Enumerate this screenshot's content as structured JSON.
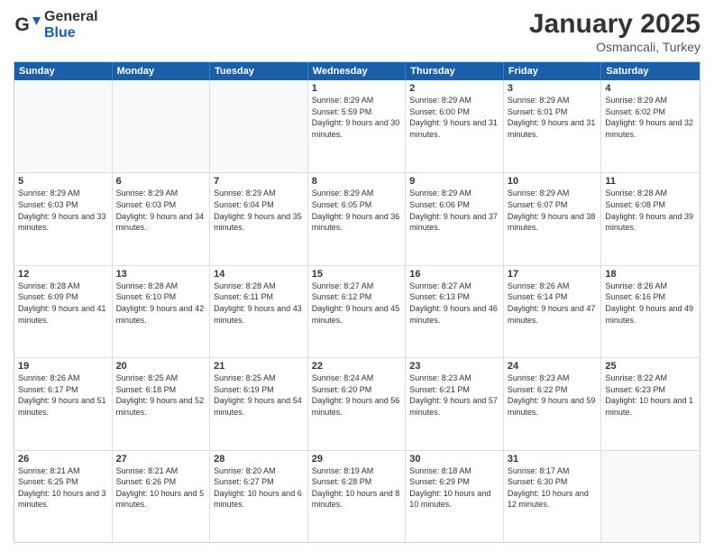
{
  "logo": {
    "general": "General",
    "blue": "Blue"
  },
  "title": "January 2025",
  "subtitle": "Osmancali, Turkey",
  "days_of_week": [
    "Sunday",
    "Monday",
    "Tuesday",
    "Wednesday",
    "Thursday",
    "Friday",
    "Saturday"
  ],
  "weeks": [
    [
      {
        "day": "",
        "info": ""
      },
      {
        "day": "",
        "info": ""
      },
      {
        "day": "",
        "info": ""
      },
      {
        "day": "1",
        "info": "Sunrise: 8:29 AM\nSunset: 5:59 PM\nDaylight: 9 hours and 30 minutes."
      },
      {
        "day": "2",
        "info": "Sunrise: 8:29 AM\nSunset: 6:00 PM\nDaylight: 9 hours and 31 minutes."
      },
      {
        "day": "3",
        "info": "Sunrise: 8:29 AM\nSunset: 6:01 PM\nDaylight: 9 hours and 31 minutes."
      },
      {
        "day": "4",
        "info": "Sunrise: 8:29 AM\nSunset: 6:02 PM\nDaylight: 9 hours and 32 minutes."
      }
    ],
    [
      {
        "day": "5",
        "info": "Sunrise: 8:29 AM\nSunset: 6:03 PM\nDaylight: 9 hours and 33 minutes."
      },
      {
        "day": "6",
        "info": "Sunrise: 8:29 AM\nSunset: 6:03 PM\nDaylight: 9 hours and 34 minutes."
      },
      {
        "day": "7",
        "info": "Sunrise: 8:29 AM\nSunset: 6:04 PM\nDaylight: 9 hours and 35 minutes."
      },
      {
        "day": "8",
        "info": "Sunrise: 8:29 AM\nSunset: 6:05 PM\nDaylight: 9 hours and 36 minutes."
      },
      {
        "day": "9",
        "info": "Sunrise: 8:29 AM\nSunset: 6:06 PM\nDaylight: 9 hours and 37 minutes."
      },
      {
        "day": "10",
        "info": "Sunrise: 8:29 AM\nSunset: 6:07 PM\nDaylight: 9 hours and 38 minutes."
      },
      {
        "day": "11",
        "info": "Sunrise: 8:28 AM\nSunset: 6:08 PM\nDaylight: 9 hours and 39 minutes."
      }
    ],
    [
      {
        "day": "12",
        "info": "Sunrise: 8:28 AM\nSunset: 6:09 PM\nDaylight: 9 hours and 41 minutes."
      },
      {
        "day": "13",
        "info": "Sunrise: 8:28 AM\nSunset: 6:10 PM\nDaylight: 9 hours and 42 minutes."
      },
      {
        "day": "14",
        "info": "Sunrise: 8:28 AM\nSunset: 6:11 PM\nDaylight: 9 hours and 43 minutes."
      },
      {
        "day": "15",
        "info": "Sunrise: 8:27 AM\nSunset: 6:12 PM\nDaylight: 9 hours and 45 minutes."
      },
      {
        "day": "16",
        "info": "Sunrise: 8:27 AM\nSunset: 6:13 PM\nDaylight: 9 hours and 46 minutes."
      },
      {
        "day": "17",
        "info": "Sunrise: 8:26 AM\nSunset: 6:14 PM\nDaylight: 9 hours and 47 minutes."
      },
      {
        "day": "18",
        "info": "Sunrise: 8:26 AM\nSunset: 6:16 PM\nDaylight: 9 hours and 49 minutes."
      }
    ],
    [
      {
        "day": "19",
        "info": "Sunrise: 8:26 AM\nSunset: 6:17 PM\nDaylight: 9 hours and 51 minutes."
      },
      {
        "day": "20",
        "info": "Sunrise: 8:25 AM\nSunset: 6:18 PM\nDaylight: 9 hours and 52 minutes."
      },
      {
        "day": "21",
        "info": "Sunrise: 8:25 AM\nSunset: 6:19 PM\nDaylight: 9 hours and 54 minutes."
      },
      {
        "day": "22",
        "info": "Sunrise: 8:24 AM\nSunset: 6:20 PM\nDaylight: 9 hours and 56 minutes."
      },
      {
        "day": "23",
        "info": "Sunrise: 8:23 AM\nSunset: 6:21 PM\nDaylight: 9 hours and 57 minutes."
      },
      {
        "day": "24",
        "info": "Sunrise: 8:23 AM\nSunset: 6:22 PM\nDaylight: 9 hours and 59 minutes."
      },
      {
        "day": "25",
        "info": "Sunrise: 8:22 AM\nSunset: 6:23 PM\nDaylight: 10 hours and 1 minute."
      }
    ],
    [
      {
        "day": "26",
        "info": "Sunrise: 8:21 AM\nSunset: 6:25 PM\nDaylight: 10 hours and 3 minutes."
      },
      {
        "day": "27",
        "info": "Sunrise: 8:21 AM\nSunset: 6:26 PM\nDaylight: 10 hours and 5 minutes."
      },
      {
        "day": "28",
        "info": "Sunrise: 8:20 AM\nSunset: 6:27 PM\nDaylight: 10 hours and 6 minutes."
      },
      {
        "day": "29",
        "info": "Sunrise: 8:19 AM\nSunset: 6:28 PM\nDaylight: 10 hours and 8 minutes."
      },
      {
        "day": "30",
        "info": "Sunrise: 8:18 AM\nSunset: 6:29 PM\nDaylight: 10 hours and 10 minutes."
      },
      {
        "day": "31",
        "info": "Sunrise: 8:17 AM\nSunset: 6:30 PM\nDaylight: 10 hours and 12 minutes."
      },
      {
        "day": "",
        "info": ""
      }
    ]
  ]
}
